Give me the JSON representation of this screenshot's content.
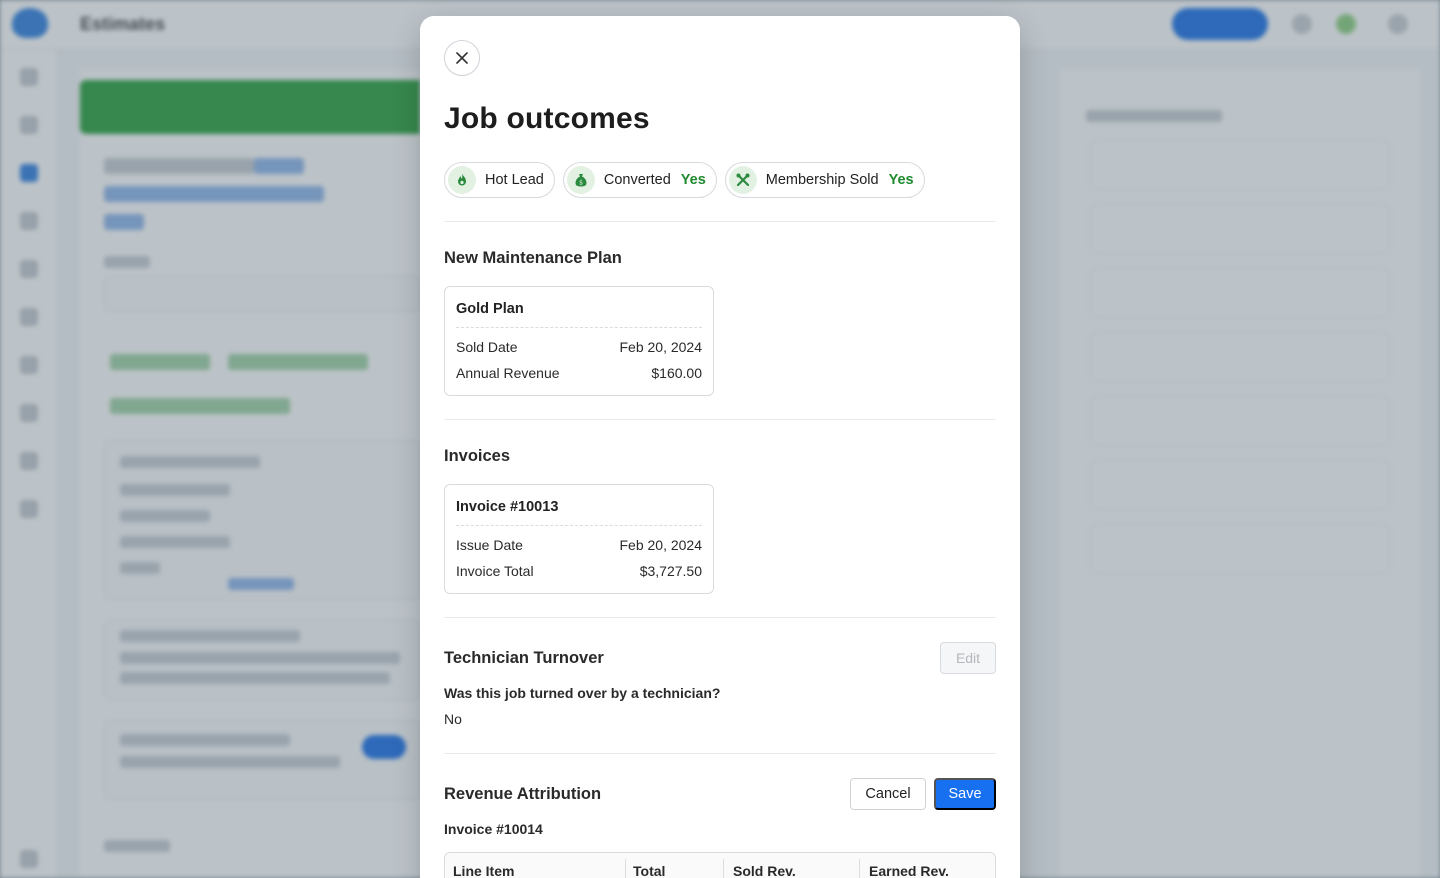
{
  "background": {
    "app_title": "Estimates"
  },
  "modal": {
    "title": "Job outcomes",
    "badges": [
      {
        "label": "Hot Lead",
        "value": "",
        "icon": "flame-icon"
      },
      {
        "label": "Converted",
        "value": "Yes",
        "icon": "money-bag-icon"
      },
      {
        "label": "Membership Sold",
        "value": "Yes",
        "icon": "tools-icon"
      }
    ],
    "maintenance": {
      "section_title": "New Maintenance Plan",
      "card_title": "Gold Plan",
      "sold_date_label": "Sold Date",
      "sold_date": "Feb 20, 2024",
      "annual_revenue_label": "Annual Revenue",
      "annual_revenue": "$160.00"
    },
    "invoices": {
      "section_title": "Invoices",
      "card_title": "Invoice #10013",
      "issue_date_label": "Issue Date",
      "issue_date": "Feb 20, 2024",
      "invoice_total_label": "Invoice Total",
      "invoice_total": "$3,727.50"
    },
    "turnover": {
      "section_title": "Technician Turnover",
      "edit_label": "Edit",
      "question": "Was this job turned over by a technician?",
      "answer": "No"
    },
    "revenue": {
      "section_title": "Revenue Attribution",
      "cancel_label": "Cancel",
      "save_label": "Save",
      "invoice_label": "Invoice #10014",
      "columns": [
        "Line Item",
        "Total",
        "Sold Rev.",
        "Earned Rev."
      ]
    }
  },
  "colors": {
    "accent": "#1670f0",
    "success": "#1f8a2f",
    "badge_icon_bg": "#e3f1e3"
  }
}
